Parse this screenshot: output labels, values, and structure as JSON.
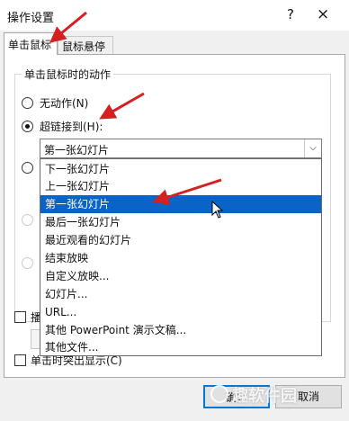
{
  "window": {
    "title": "操作设置",
    "help_label": "?",
    "close_label": "×"
  },
  "tabs": [
    {
      "label": "单击鼠标"
    },
    {
      "label": "鼠标悬停"
    }
  ],
  "action_group": {
    "title": "单击鼠标时的动作",
    "options": [
      {
        "label": "无动作(N)",
        "checked": false
      },
      {
        "label": "超链接到(H):",
        "checked": true
      }
    ]
  },
  "hyperlink_select": {
    "value": "第一张幻灯片",
    "options": [
      "下一张幻灯片",
      "上一张幻灯片",
      "第一张幻灯片",
      "最后一张幻灯片",
      "最近观看的幻灯片",
      "结束放映",
      "自定义放映...",
      "幻灯片...",
      "URL...",
      "其他 PowerPoint 演示文稿...",
      "其他文件..."
    ],
    "highlighted_index": 2
  },
  "partial": {
    "checkbox1_label": "播",
    "highlight_click_label": "单击时突出显示(C)"
  },
  "buttons": {
    "ok": "确定",
    "cancel": "取消"
  },
  "watermark": {
    "text": "趣软件园"
  },
  "colors": {
    "selection": "#0a64c8",
    "annotation_arrow": "#d42020"
  }
}
